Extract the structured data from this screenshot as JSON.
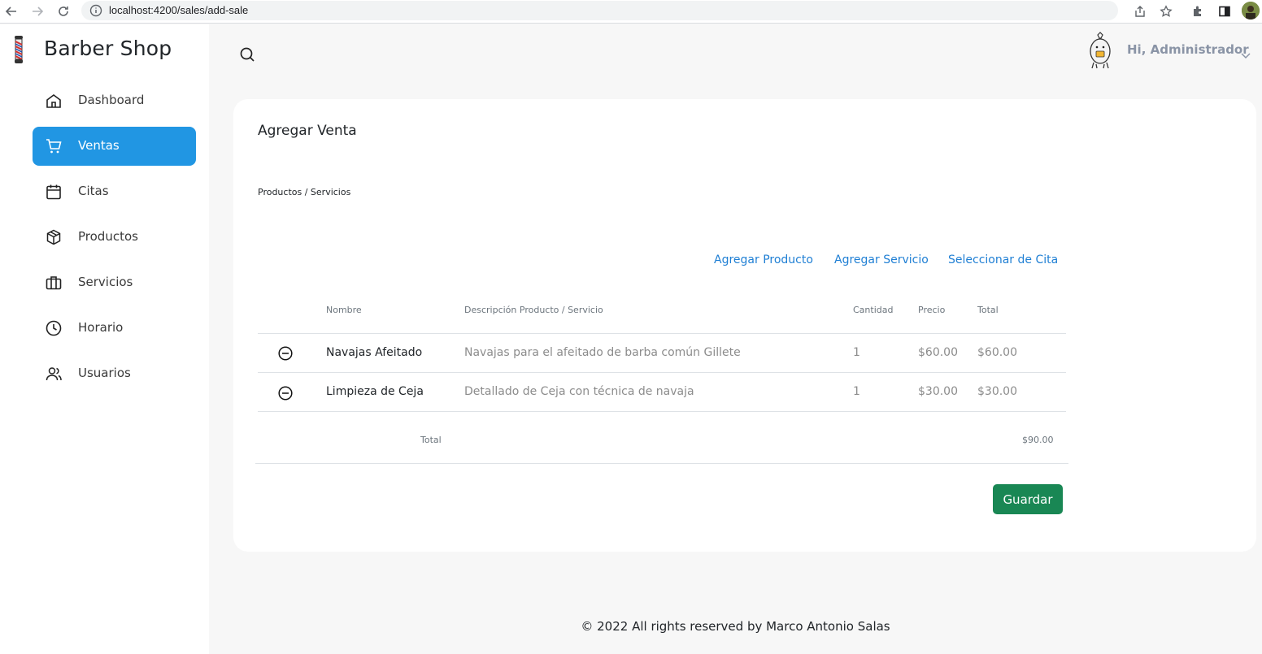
{
  "browser": {
    "url": "localhost:4200/sales/add-sale"
  },
  "brand": {
    "name": "Barber Shop"
  },
  "sidebar": {
    "items": [
      {
        "label": "Dashboard",
        "icon": "home-icon",
        "active": false
      },
      {
        "label": "Ventas",
        "icon": "cart-icon",
        "active": true
      },
      {
        "label": "Citas",
        "icon": "calendar-icon",
        "active": false
      },
      {
        "label": "Productos",
        "icon": "box-icon",
        "active": false
      },
      {
        "label": "Servicios",
        "icon": "briefcase-icon",
        "active": false
      },
      {
        "label": "Horario",
        "icon": "clock-icon",
        "active": false
      },
      {
        "label": "Usuarios",
        "icon": "users-icon",
        "active": false
      }
    ]
  },
  "header": {
    "greeting": "Hi,",
    "user_name": "Administrador"
  },
  "card": {
    "title": "Agregar Venta",
    "breadcrumb": "Productos / Servicios",
    "actions": {
      "add_product": "Agregar Producto",
      "add_service": "Agregar Servicio",
      "select_appointment": "Seleccionar de Cita"
    },
    "table": {
      "headers": {
        "name": "Nombre",
        "description": "Descripción Producto / Servicio",
        "quantity": "Cantidad",
        "price": "Precio",
        "total": "Total"
      },
      "rows": [
        {
          "name": "Navajas Afeitado",
          "description": "Navajas para el afeitado de barba común Gillete",
          "quantity": "1",
          "price": "$60.00",
          "total": "$60.00"
        },
        {
          "name": "Limpieza de Ceja",
          "description": "Detallado de Ceja con técnica de navaja",
          "quantity": "1",
          "price": "$30.00",
          "total": "$30.00"
        }
      ],
      "total_label": "Total",
      "total_value": "$90.00"
    },
    "save_label": "Guardar"
  },
  "footer": {
    "text": "© 2022 All rights reserved by Marco Antonio Salas"
  },
  "colors": {
    "accent": "#2196e3",
    "link": "#1f7fd4",
    "save": "#198754"
  }
}
